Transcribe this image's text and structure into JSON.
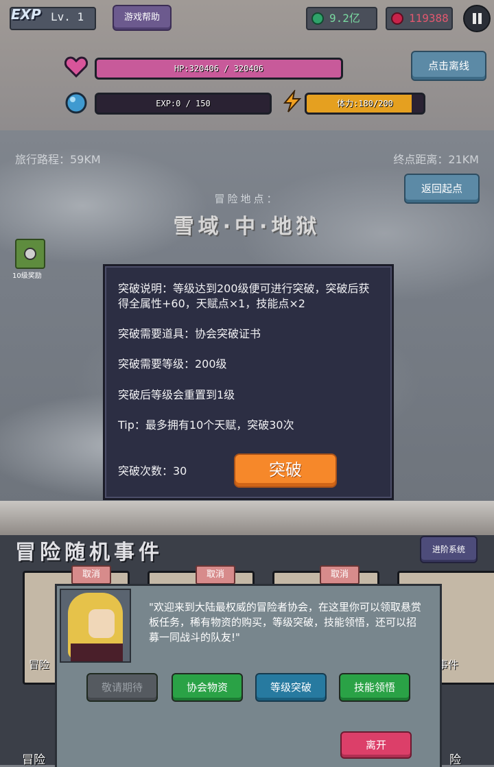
{
  "hud": {
    "exp_logo": "EXP",
    "level": "Lv. 1",
    "help_label": "游戏帮助",
    "green_gem_value": "9.2亿",
    "red_gem_value": "119388",
    "offline_label": "点击离线",
    "hp_text": "HP:320406 / 320406",
    "hp_fraction": 1.0,
    "exp_text": "EXP:0 / 150",
    "exp_fraction": 0.0,
    "stamina_text": "体力:180/200",
    "stamina_fraction": 0.9
  },
  "journey": {
    "travel_label": "旅行路程：59KM",
    "dest_label": "终点距离：21KM",
    "return_label": "返回起点",
    "location_caption": "冒险地点：",
    "location_name": "雪域·中·地狱",
    "reward_label": "10级奖励"
  },
  "breakthrough": {
    "desc": "突破说明：等级达到200级便可进行突破，突破后获得全属性+60，天赋点×1，技能点×2",
    "item": "突破需要道具：协会突破证书",
    "level": "突破需要等级：200级",
    "reset": "突破后等级会重置到1级",
    "tip": "Tip：最多拥有10个天赋，突破30次",
    "count": "突破次数：30",
    "button": "突破"
  },
  "events": {
    "title": "冒险随机事件",
    "advance_label": "进阶系统",
    "cancel_label": "取消",
    "card_left_text": "冒险",
    "card_right_text": "事件",
    "bottom_left": "冒险",
    "bottom_right": "险"
  },
  "guild": {
    "message": "\"欢迎来到大陆最权威的冒险者协会，在这里你可以领取悬赏板任务，稀有物资的购买，等级突破，技能领悟，还可以招募一同战斗的队友!\"",
    "btn_coming": "敬请期待",
    "btn_supplies": "协会物资",
    "btn_break": "等级突破",
    "btn_skill": "技能领悟",
    "btn_leave": "离开"
  },
  "colors": {
    "hp_bar": "#c85a9a",
    "exp_bar": "#5a3fa8",
    "stamina_bar": "#e5a020",
    "accent_orange": "#f6882a"
  }
}
